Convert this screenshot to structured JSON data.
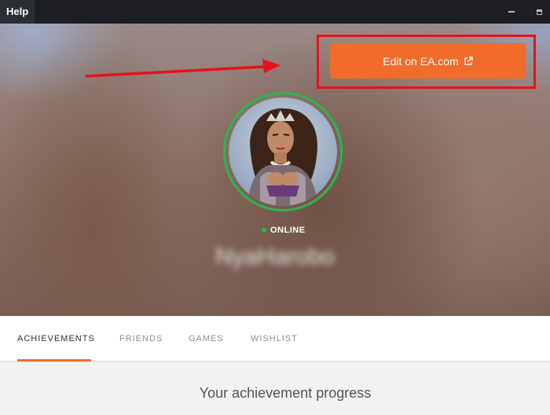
{
  "titlebar": {
    "menu": "Help",
    "minimize_icon": "minimize-icon",
    "maximize_icon": "maximize-icon"
  },
  "profile": {
    "edit_button": {
      "label": "Edit on EA.com",
      "icon": "external-link-icon"
    },
    "status": "ONLINE",
    "username": "NyaHarobo"
  },
  "tabs": [
    {
      "label": "ACHIEVEMENTS",
      "active": true
    },
    {
      "label": "FRIENDS",
      "active": false
    },
    {
      "label": "GAMES",
      "active": false
    },
    {
      "label": "WISHLIST",
      "active": false
    }
  ],
  "section": {
    "title": "Your achievement progress"
  },
  "colors": {
    "accent": "#f16b2a",
    "online": "#1fbe4a",
    "annotation": "#e3131d"
  }
}
